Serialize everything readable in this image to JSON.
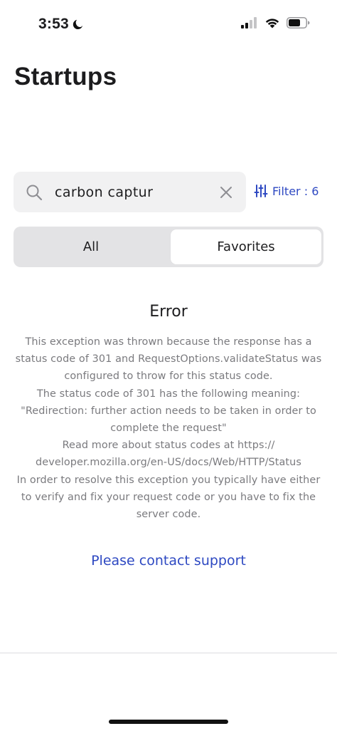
{
  "status_bar": {
    "time": "3:53",
    "icons": [
      "moon-icon",
      "cellular-signal-icon",
      "wifi-icon",
      "battery-icon"
    ]
  },
  "page": {
    "title": "Startups"
  },
  "search": {
    "value": "carbon captur",
    "icon": "search-icon",
    "clear_icon": "close-icon"
  },
  "filter": {
    "label": "Filter : 6",
    "icon": "sliders-icon",
    "accent_color": "#2e49c2"
  },
  "segments": {
    "items": [
      {
        "label": "All",
        "selected": false
      },
      {
        "label": "Favorites",
        "selected": true
      }
    ]
  },
  "error": {
    "title": "Error",
    "lines": [
      "This exception was thrown because the response has a",
      "status code of 301 and RequestOptions.validateStatus was",
      "configured to throw for this status code.",
      "The status code of 301 has the following meaning:",
      "\"Redirection: further action needs to be taken in order to",
      "complete the request\"",
      "Read more about status codes at https://",
      "developer.mozilla.org/en-US/docs/Web/HTTP/Status",
      "In order to resolve this exception you typically have either",
      "to verify and fix your request code or you have to fix the",
      "server code."
    ]
  },
  "support": {
    "label": "Please contact support"
  }
}
